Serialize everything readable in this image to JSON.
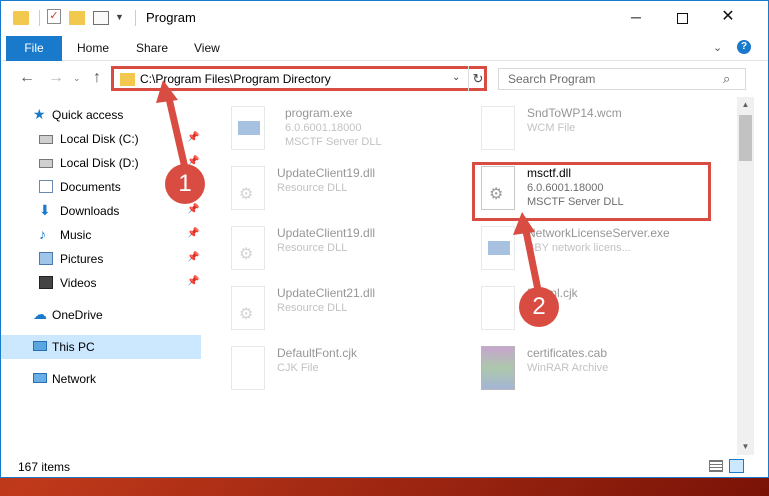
{
  "window": {
    "title": "Program",
    "minimize_glyph": "─",
    "close_glyph": "✕"
  },
  "ribbon": {
    "tabs": [
      "File",
      "Home",
      "Share",
      "View"
    ],
    "help_glyph": "?",
    "collapse_glyph": "⌄"
  },
  "navigation": {
    "back_glyph": "←",
    "forward_glyph": "→",
    "recent_glyph": "⌄",
    "up_glyph": "↑",
    "address": "C:\\Program Files\\Program Directory",
    "address_dropdown_glyph": "⌄",
    "refresh_glyph": "↻",
    "search_placeholder": "Search Program",
    "search_glyph": "⌕"
  },
  "sidebar": {
    "quick_access": "Quick access",
    "items": [
      {
        "label": "Local Disk (C:)",
        "icon": "disk-icon",
        "pinned": true
      },
      {
        "label": "Local Disk (D:)",
        "icon": "disk-icon",
        "pinned": true
      },
      {
        "label": "Documents",
        "icon": "documents-icon",
        "pinned": true
      },
      {
        "label": "Downloads",
        "icon": "downloads-icon",
        "pinned": true
      },
      {
        "label": "Music",
        "icon": "music-icon",
        "pinned": true
      },
      {
        "label": "Pictures",
        "icon": "pictures-icon",
        "pinned": true
      },
      {
        "label": "Videos",
        "icon": "videos-icon",
        "pinned": true
      }
    ],
    "onedrive": "OneDrive",
    "this_pc": "This PC",
    "network": "Network",
    "pin_glyph": "📌"
  },
  "files": [
    {
      "name": "program.exe",
      "line1": "6.0.6001.18000",
      "line2": "MSCTF Server DLL",
      "icon": "exe-icon"
    },
    {
      "name": "SndToWP14.wcm",
      "line1": "WCM File",
      "line2": "",
      "icon": "file-icon"
    },
    {
      "name": "UpdateClient19.dll",
      "line1": "Resource DLL",
      "line2": "",
      "icon": "dll-icon"
    },
    {
      "name": "msctf.dll",
      "line1": "6.0.6001.18000",
      "line2": "MSCTF Server DLL",
      "icon": "dll-icon"
    },
    {
      "name": "UpdateClient19.dll",
      "line1": "Resource DLL",
      "line2": "",
      "icon": "dll-icon"
    },
    {
      "name": "NetworkLicenseServer.exe",
      "line1": "BBY network licens...",
      "line2": "",
      "icon": "exe-icon"
    },
    {
      "name": "UpdateClient21.dll",
      "line1": "Resource DLL",
      "line2": "",
      "icon": "dll-icon"
    },
    {
      "name": "fontml.cjk",
      "line1": "",
      "line2": "",
      "icon": "file-icon"
    },
    {
      "name": "DefaultFont.cjk",
      "line1": "CJK File",
      "line2": "",
      "icon": "file-icon"
    },
    {
      "name": "certificates.cab",
      "line1": "WinRAR Archive",
      "line2": "",
      "icon": "rar-icon"
    }
  ],
  "status": {
    "items_count": "167 items"
  },
  "callouts": [
    "1",
    "2"
  ],
  "colors": {
    "accent": "#1979ca",
    "highlight": "#d94c42",
    "selection": "#cce8ff"
  }
}
